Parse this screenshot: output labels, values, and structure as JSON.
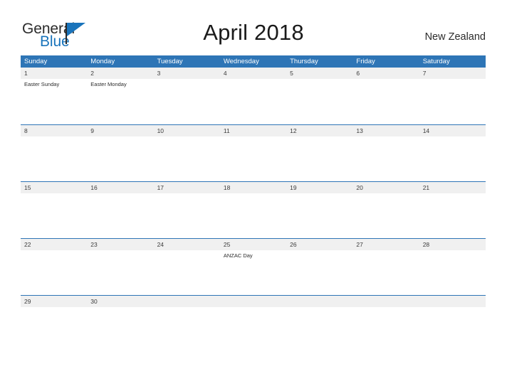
{
  "brand": {
    "name_part1": "General",
    "name_part2": "Blue",
    "flag_icon": "blue-flag-triangle-icon",
    "color_primary": "#1a74bb",
    "color_text": "#2b2b2b"
  },
  "header": {
    "title": "April 2018",
    "location": "New Zealand"
  },
  "theme": {
    "header_blue": "#2e75b6",
    "row_divider_blue": "#2e75b6",
    "date_band_gray": "#f0f0f0",
    "page_background": "#ffffff"
  },
  "weekdays": [
    {
      "label": "Sunday"
    },
    {
      "label": "Monday"
    },
    {
      "label": "Tuesday"
    },
    {
      "label": "Wednesday"
    },
    {
      "label": "Thursday"
    },
    {
      "label": "Friday"
    },
    {
      "label": "Saturday"
    }
  ],
  "weeks": [
    {
      "days": [
        {
          "date": "1",
          "events": [
            "Easter Sunday"
          ]
        },
        {
          "date": "2",
          "events": [
            "Easter Monday"
          ]
        },
        {
          "date": "3",
          "events": []
        },
        {
          "date": "4",
          "events": []
        },
        {
          "date": "5",
          "events": []
        },
        {
          "date": "6",
          "events": []
        },
        {
          "date": "7",
          "events": []
        }
      ]
    },
    {
      "days": [
        {
          "date": "8",
          "events": []
        },
        {
          "date": "9",
          "events": []
        },
        {
          "date": "10",
          "events": []
        },
        {
          "date": "11",
          "events": []
        },
        {
          "date": "12",
          "events": []
        },
        {
          "date": "13",
          "events": []
        },
        {
          "date": "14",
          "events": []
        }
      ]
    },
    {
      "days": [
        {
          "date": "15",
          "events": []
        },
        {
          "date": "16",
          "events": []
        },
        {
          "date": "17",
          "events": []
        },
        {
          "date": "18",
          "events": []
        },
        {
          "date": "19",
          "events": []
        },
        {
          "date": "20",
          "events": []
        },
        {
          "date": "21",
          "events": []
        }
      ]
    },
    {
      "days": [
        {
          "date": "22",
          "events": []
        },
        {
          "date": "23",
          "events": []
        },
        {
          "date": "24",
          "events": []
        },
        {
          "date": "25",
          "events": [
            "ANZAC Day"
          ]
        },
        {
          "date": "26",
          "events": []
        },
        {
          "date": "27",
          "events": []
        },
        {
          "date": "28",
          "events": []
        }
      ]
    },
    {
      "days": [
        {
          "date": "29",
          "events": []
        },
        {
          "date": "30",
          "events": []
        },
        {
          "date": "",
          "events": []
        },
        {
          "date": "",
          "events": []
        },
        {
          "date": "",
          "events": []
        },
        {
          "date": "",
          "events": []
        },
        {
          "date": "",
          "events": []
        }
      ]
    }
  ]
}
